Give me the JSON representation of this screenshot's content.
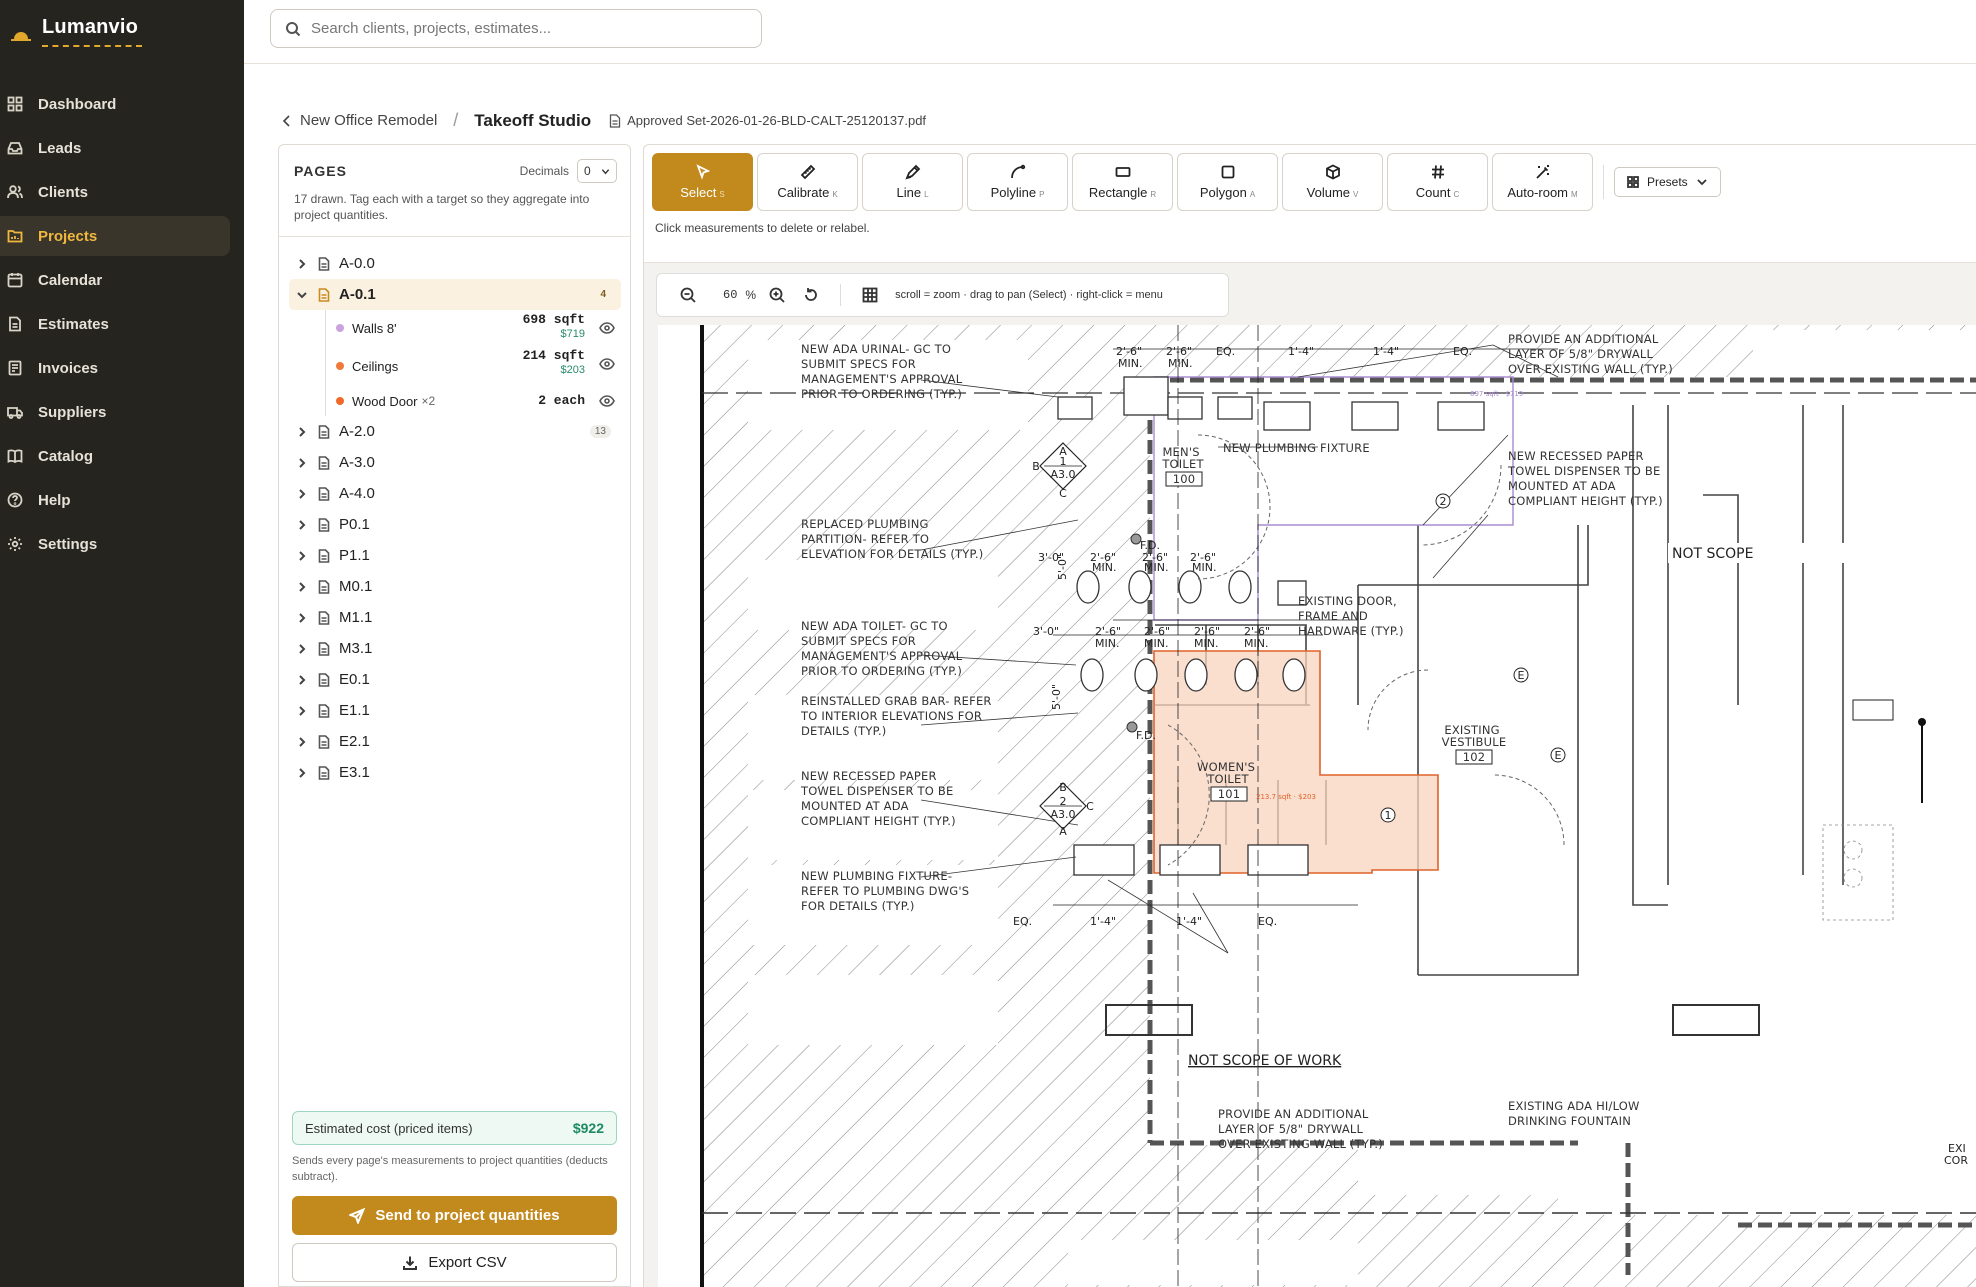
{
  "app": {
    "name": "Lumanvio"
  },
  "sidebar": {
    "items": [
      {
        "label": "Dashboard",
        "icon": "grid-icon",
        "active": false
      },
      {
        "label": "Leads",
        "icon": "inbox-icon",
        "active": false
      },
      {
        "label": "Clients",
        "icon": "users-icon",
        "active": false
      },
      {
        "label": "Projects",
        "icon": "folder-icon",
        "active": true
      },
      {
        "label": "Calendar",
        "icon": "calendar-icon",
        "active": false
      },
      {
        "label": "Estimates",
        "icon": "document-icon",
        "active": false
      },
      {
        "label": "Invoices",
        "icon": "invoice-icon",
        "active": false
      },
      {
        "label": "Suppliers",
        "icon": "truck-icon",
        "active": false
      },
      {
        "label": "Catalog",
        "icon": "book-icon",
        "active": false
      },
      {
        "label": "Help",
        "icon": "help-icon",
        "active": false
      },
      {
        "label": "Settings",
        "icon": "gear-icon",
        "active": false
      }
    ]
  },
  "search": {
    "placeholder": "Search clients, projects, estimates..."
  },
  "breadcrumb": {
    "back_label": "New Office Remodel",
    "separator": "/",
    "title": "Takeoff Studio",
    "file": "Approved Set-2026-01-26-BLD-CALT-25120137.pdf"
  },
  "pages_panel": {
    "heading": "PAGES",
    "decimals_label": "Decimals",
    "decimals_value": "0",
    "help": "17 drawn. Tag each with a target so they aggregate into project quantities.",
    "pages": [
      {
        "name": "A-0.0",
        "count": ""
      },
      {
        "name": "A-0.1",
        "count": "4",
        "expanded": true
      },
      {
        "name": "A-2.0",
        "count": "13"
      },
      {
        "name": "A-3.0",
        "count": ""
      },
      {
        "name": "A-4.0",
        "count": ""
      },
      {
        "name": "P0.1",
        "count": ""
      },
      {
        "name": "P1.1",
        "count": ""
      },
      {
        "name": "M0.1",
        "count": ""
      },
      {
        "name": "M1.1",
        "count": ""
      },
      {
        "name": "M3.1",
        "count": ""
      },
      {
        "name": "E0.1",
        "count": ""
      },
      {
        "name": "E1.1",
        "count": ""
      },
      {
        "name": "E2.1",
        "count": ""
      },
      {
        "name": "E3.1",
        "count": ""
      }
    ],
    "measurements": [
      {
        "label": "Walls 8'",
        "color": "#c9a4dc",
        "qty": "698 sqft",
        "price": "$719",
        "mult": ""
      },
      {
        "label": "Ceilings",
        "color": "#ef7a3a",
        "qty": "214 sqft",
        "price": "$203",
        "mult": ""
      },
      {
        "label": "Wood Door",
        "color": "#ef6a2a",
        "qty": "2 each",
        "price": "",
        "mult": "×2"
      }
    ],
    "estimate_label": "Estimated cost (priced items)",
    "estimate_value": "$922",
    "send_note": "Sends every page's measurements to project quantities (deducts subtract).",
    "send_label": "Send to project quantities",
    "export_label": "Export CSV"
  },
  "toolbar": {
    "tools": [
      {
        "label": "Select",
        "key": "S",
        "icon": "cursor-icon",
        "active": true
      },
      {
        "label": "Calibrate",
        "key": "K",
        "icon": "ruler-icon",
        "active": false
      },
      {
        "label": "Line",
        "key": "L",
        "icon": "pen-icon",
        "active": false
      },
      {
        "label": "Polyline",
        "key": "P",
        "icon": "polyline-icon",
        "active": false
      },
      {
        "label": "Rectangle",
        "key": "R",
        "icon": "rectangle-icon",
        "active": false
      },
      {
        "label": "Polygon",
        "key": "A",
        "icon": "polygon-icon",
        "active": false
      },
      {
        "label": "Volume",
        "key": "V",
        "icon": "cube-icon",
        "active": false
      },
      {
        "label": "Count",
        "key": "C",
        "icon": "hash-icon",
        "active": false
      },
      {
        "label": "Auto-room",
        "key": "M",
        "icon": "wand-icon",
        "active": false
      }
    ],
    "presets_label": "Presets",
    "hint": "Click measurements to delete or relabel."
  },
  "canvas": {
    "zoom_value": "60",
    "zoom_unit": "%",
    "help": "scroll = zoom · drag to pan (Select) · right-click = menu"
  },
  "drawing": {
    "notes": [
      [
        "NEW ADA URINAL- GC TO",
        "SUBMIT SPECS FOR",
        "MANAGEMENT'S APPROVAL",
        "PRIOR TO ORDERING (TYP.)"
      ],
      [
        "REPLACED PLUMBING",
        "PARTITION- REFER TO",
        "ELEVATION FOR DETAILS (TYP.)"
      ],
      [
        "NEW ADA TOILET- GC TO",
        "SUBMIT SPECS FOR",
        "MANAGEMENT'S APPROVAL",
        "PRIOR TO ORDERING (TYP.)"
      ],
      [
        "REINSTALLED GRAB BAR- REFER",
        "TO INTERIOR ELEVATIONS FOR",
        "DETAILS (TYP.)"
      ],
      [
        "NEW RECESSED PAPER",
        "TOWEL DISPENSER TO BE",
        "MOUNTED AT ADA",
        "COMPLIANT HEIGHT (TYP.)"
      ],
      [
        "NEW PLUMBING FIXTURE-",
        "REFER TO PLUMBING DWG'S",
        "FOR DETAILS (TYP.)"
      ],
      [
        "PROVIDE AN ADDITIONAL",
        "LAYER OF 5/8\" DRYWALL",
        "OVER EXISTING WALL (TYP.)"
      ],
      [
        "NEW RECESSED PAPER",
        "TOWEL DISPENSER TO BE",
        "MOUNTED AT ADA",
        "COMPLIANT HEIGHT (TYP.)"
      ],
      [
        "EXISTING DOOR,",
        "FRAME AND",
        "HARDWARE (TYP.)"
      ],
      [
        "PROVIDE AN ADDITIONAL",
        "LAYER OF 5/8\" DRYWALL",
        "OVER EXISTING WALL (TYP.)"
      ],
      [
        "EXISTING ADA HI/LOW",
        "DRINKING FOUNTAIN"
      ]
    ],
    "new_fixture": "NEW PLUMBING FIXTURE",
    "mens_room": [
      "MEN'S",
      "TOILET",
      "100"
    ],
    "womens_room": [
      "WOMEN'S",
      "TOILET",
      "101"
    ],
    "vestibule": [
      "EXISTING",
      "VESTIBULE",
      "102"
    ],
    "not_scope": "NOT SCOPE OF WORK",
    "not_scope_short": "NOT SCOPE",
    "overlay_label": "213.7 sqft · $203",
    "walls_overlay_label": "697 sqft · $719",
    "dims_top": [
      "2'-6\"",
      "MIN.",
      "2'-6\"",
      "MIN.",
      "EQ.",
      "1'-4\"",
      "1'-4\"",
      "EQ."
    ],
    "dims_mid": [
      "3'-0\"",
      "2'-6\"",
      "MIN.",
      "2'-6\"",
      "MIN.",
      "2'-6\"",
      "MIN."
    ],
    "dims_low": [
      "3'-0\"",
      "2'-6\"",
      "MIN.",
      "2'-6\"",
      "MIN.",
      "2'-6\"",
      "MIN.",
      "2'-6\"",
      "MIN."
    ],
    "dims_bottom": [
      "EQ.",
      "1'-4\"",
      "1'-4\"",
      "EQ."
    ],
    "tags": [
      "A",
      "1",
      "A3.0",
      "B",
      "C",
      "A",
      "2",
      "A3.0",
      "B",
      "C",
      "E",
      "E",
      "1",
      "2",
      "F.D.",
      "F.D.",
      "5'-0\"",
      "5'-0\"",
      "EXI",
      "COR"
    ]
  },
  "colors": {
    "accent": "#c2891c",
    "sidebar_bg": "#26241f",
    "active_nav": "#f0b93e",
    "price_green": "#2a8c6b",
    "overlay_fill": "#f8d3bd",
    "overlay_stroke": "#e0622a",
    "walls_stroke": "#a98bd0"
  }
}
